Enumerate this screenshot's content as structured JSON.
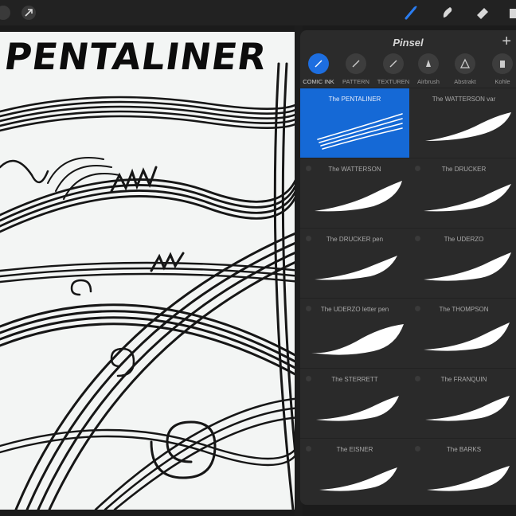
{
  "toolbar": {
    "left_icons": [
      "wrench-icon",
      "cursor-arrow-icon"
    ],
    "right_icons": [
      "brush-icon",
      "smudge-icon",
      "eraser-icon",
      "layers-icon"
    ],
    "active_tool": "brush",
    "accent": "#1d6ee0"
  },
  "canvas": {
    "title": "PENTALINER"
  },
  "panel": {
    "title": "Pinsel",
    "add_label": "+"
  },
  "categories": [
    {
      "label": "COMIC INK",
      "icon": "pen-nib-icon",
      "active": true
    },
    {
      "label": "PATTERN",
      "icon": "pencil-icon",
      "active": false
    },
    {
      "label": "TEXTUREN",
      "icon": "pencil-icon",
      "active": false
    },
    {
      "label": "Airbrush",
      "icon": "airbrush-icon",
      "active": false
    },
    {
      "label": "Abstrakt",
      "icon": "triangle-icon",
      "active": false
    },
    {
      "label": "Kohle",
      "icon": "charcoal-icon",
      "active": false
    }
  ],
  "brushes": [
    {
      "name": "The PENTALINER",
      "selected": true
    },
    {
      "name": "The WATTERSON var",
      "selected": false
    },
    {
      "name": "The WATTERSON",
      "selected": false
    },
    {
      "name": "The DRUCKER",
      "selected": false
    },
    {
      "name": "The DRUCKER pen",
      "selected": false
    },
    {
      "name": "The UDERZO",
      "selected": false
    },
    {
      "name": "The UDERZO letter pen",
      "selected": false
    },
    {
      "name": "The THOMPSON",
      "selected": false
    },
    {
      "name": "The STERRETT",
      "selected": false
    },
    {
      "name": "The FRANQUIN",
      "selected": false
    },
    {
      "name": "The EISNER",
      "selected": false
    },
    {
      "name": "The BARKS",
      "selected": false
    }
  ]
}
